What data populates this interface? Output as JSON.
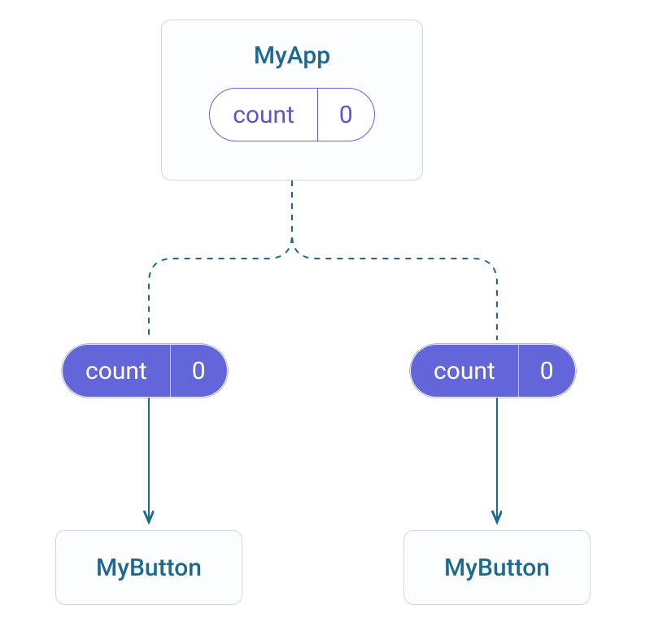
{
  "diagram": {
    "parent": {
      "title": "MyApp",
      "pill": {
        "label": "count",
        "value": "0"
      }
    },
    "children": [
      {
        "pill": {
          "label": "count",
          "value": "0"
        },
        "card": {
          "title": "MyButton"
        }
      },
      {
        "pill": {
          "label": "count",
          "value": "0"
        },
        "card": {
          "title": "MyButton"
        }
      }
    ]
  },
  "colors": {
    "accent": "#1e6a8e",
    "pill": "#6366d8",
    "cardBorder": "#cfd6e0",
    "cardBg": "#fcfdff"
  }
}
